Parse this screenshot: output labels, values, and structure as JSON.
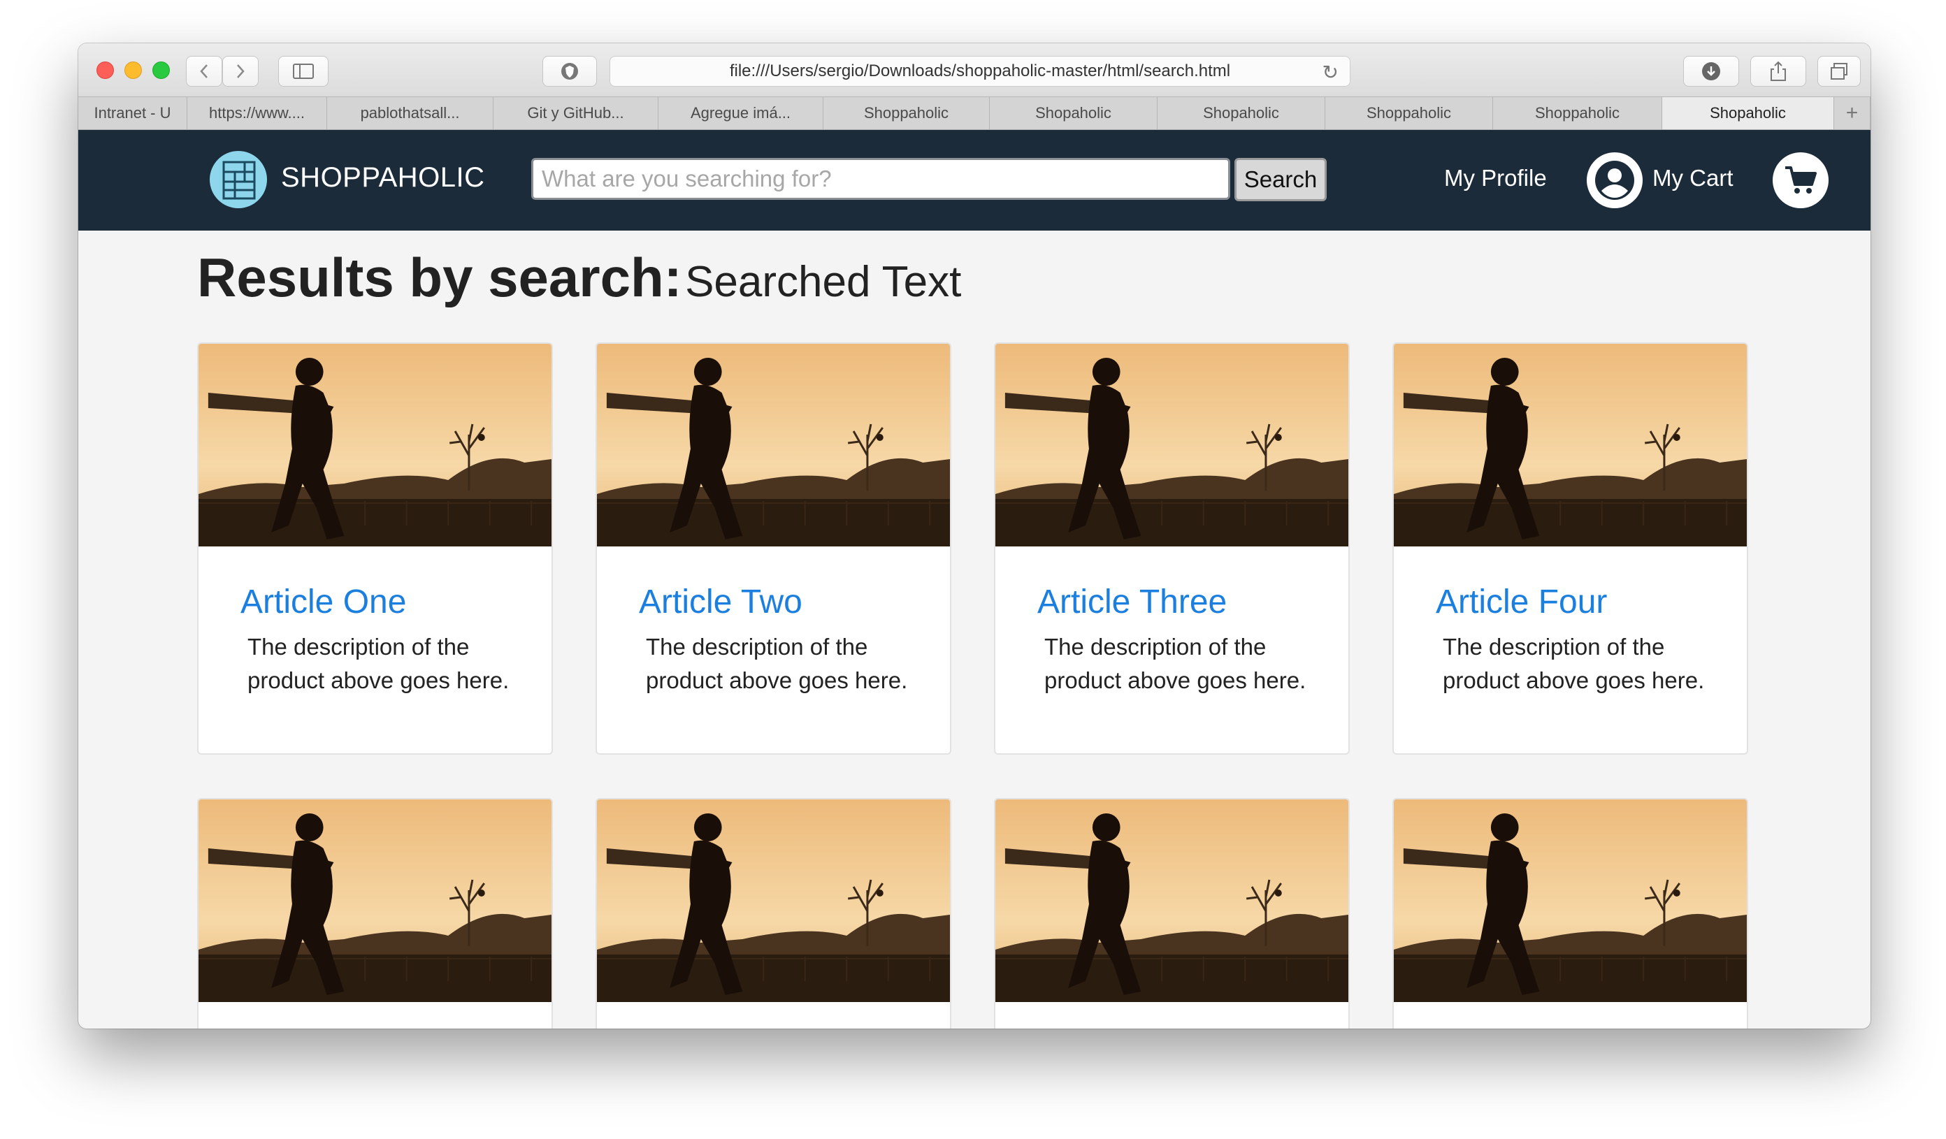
{
  "browser": {
    "address": "file:///Users/sergio/Downloads/shoppaholic-master/html/search.html",
    "tabs": [
      {
        "label": "Intranet - U"
      },
      {
        "label": "https://www...."
      },
      {
        "label": "pablothatsall..."
      },
      {
        "label": "Git y GitHub..."
      },
      {
        "label": "Agregue imá..."
      },
      {
        "label": "Shoppaholic"
      },
      {
        "label": "Shopaholic"
      },
      {
        "label": "Shopaholic"
      },
      {
        "label": "Shoppaholic"
      },
      {
        "label": "Shoppaholic"
      },
      {
        "label": "Shopaholic"
      }
    ],
    "new_tab": "+"
  },
  "navbar": {
    "brand": "SHOPPAHOLIC",
    "search_placeholder": "What are you searching for?",
    "search_button": "Search",
    "profile_label": "My Profile",
    "cart_label": "My Cart"
  },
  "main": {
    "heading_prefix": "Results by search:",
    "heading_query": "Searched Text",
    "cards": [
      {
        "title": "Article One",
        "description": "The description of the product above goes here."
      },
      {
        "title": "Article Two",
        "description": "The description of the product above goes here."
      },
      {
        "title": "Article Three",
        "description": "The description of the product above goes here."
      },
      {
        "title": "Article Four",
        "description": "The description of the product above goes here."
      }
    ]
  },
  "colors": {
    "navbar": "#1b2b3a",
    "link": "#1b7fe0",
    "background": "#f4f4f4"
  }
}
